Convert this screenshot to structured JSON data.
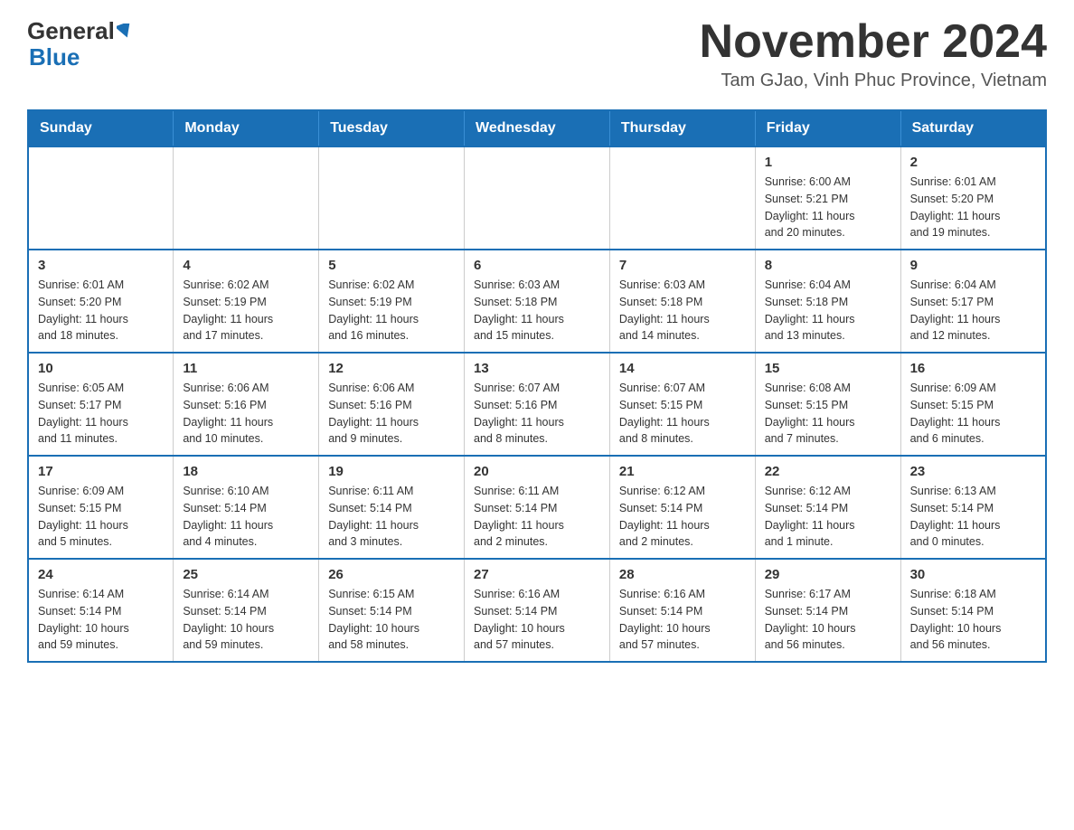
{
  "header": {
    "logo_general": "General",
    "logo_blue": "Blue",
    "title": "November 2024",
    "location": "Tam GJao, Vinh Phuc Province, Vietnam"
  },
  "calendar": {
    "days_of_week": [
      "Sunday",
      "Monday",
      "Tuesday",
      "Wednesday",
      "Thursday",
      "Friday",
      "Saturday"
    ],
    "weeks": [
      [
        {
          "day": "",
          "info": ""
        },
        {
          "day": "",
          "info": ""
        },
        {
          "day": "",
          "info": ""
        },
        {
          "day": "",
          "info": ""
        },
        {
          "day": "",
          "info": ""
        },
        {
          "day": "1",
          "info": "Sunrise: 6:00 AM\nSunset: 5:21 PM\nDaylight: 11 hours\nand 20 minutes."
        },
        {
          "day": "2",
          "info": "Sunrise: 6:01 AM\nSunset: 5:20 PM\nDaylight: 11 hours\nand 19 minutes."
        }
      ],
      [
        {
          "day": "3",
          "info": "Sunrise: 6:01 AM\nSunset: 5:20 PM\nDaylight: 11 hours\nand 18 minutes."
        },
        {
          "day": "4",
          "info": "Sunrise: 6:02 AM\nSunset: 5:19 PM\nDaylight: 11 hours\nand 17 minutes."
        },
        {
          "day": "5",
          "info": "Sunrise: 6:02 AM\nSunset: 5:19 PM\nDaylight: 11 hours\nand 16 minutes."
        },
        {
          "day": "6",
          "info": "Sunrise: 6:03 AM\nSunset: 5:18 PM\nDaylight: 11 hours\nand 15 minutes."
        },
        {
          "day": "7",
          "info": "Sunrise: 6:03 AM\nSunset: 5:18 PM\nDaylight: 11 hours\nand 14 minutes."
        },
        {
          "day": "8",
          "info": "Sunrise: 6:04 AM\nSunset: 5:18 PM\nDaylight: 11 hours\nand 13 minutes."
        },
        {
          "day": "9",
          "info": "Sunrise: 6:04 AM\nSunset: 5:17 PM\nDaylight: 11 hours\nand 12 minutes."
        }
      ],
      [
        {
          "day": "10",
          "info": "Sunrise: 6:05 AM\nSunset: 5:17 PM\nDaylight: 11 hours\nand 11 minutes."
        },
        {
          "day": "11",
          "info": "Sunrise: 6:06 AM\nSunset: 5:16 PM\nDaylight: 11 hours\nand 10 minutes."
        },
        {
          "day": "12",
          "info": "Sunrise: 6:06 AM\nSunset: 5:16 PM\nDaylight: 11 hours\nand 9 minutes."
        },
        {
          "day": "13",
          "info": "Sunrise: 6:07 AM\nSunset: 5:16 PM\nDaylight: 11 hours\nand 8 minutes."
        },
        {
          "day": "14",
          "info": "Sunrise: 6:07 AM\nSunset: 5:15 PM\nDaylight: 11 hours\nand 8 minutes."
        },
        {
          "day": "15",
          "info": "Sunrise: 6:08 AM\nSunset: 5:15 PM\nDaylight: 11 hours\nand 7 minutes."
        },
        {
          "day": "16",
          "info": "Sunrise: 6:09 AM\nSunset: 5:15 PM\nDaylight: 11 hours\nand 6 minutes."
        }
      ],
      [
        {
          "day": "17",
          "info": "Sunrise: 6:09 AM\nSunset: 5:15 PM\nDaylight: 11 hours\nand 5 minutes."
        },
        {
          "day": "18",
          "info": "Sunrise: 6:10 AM\nSunset: 5:14 PM\nDaylight: 11 hours\nand 4 minutes."
        },
        {
          "day": "19",
          "info": "Sunrise: 6:11 AM\nSunset: 5:14 PM\nDaylight: 11 hours\nand 3 minutes."
        },
        {
          "day": "20",
          "info": "Sunrise: 6:11 AM\nSunset: 5:14 PM\nDaylight: 11 hours\nand 2 minutes."
        },
        {
          "day": "21",
          "info": "Sunrise: 6:12 AM\nSunset: 5:14 PM\nDaylight: 11 hours\nand 2 minutes."
        },
        {
          "day": "22",
          "info": "Sunrise: 6:12 AM\nSunset: 5:14 PM\nDaylight: 11 hours\nand 1 minute."
        },
        {
          "day": "23",
          "info": "Sunrise: 6:13 AM\nSunset: 5:14 PM\nDaylight: 11 hours\nand 0 minutes."
        }
      ],
      [
        {
          "day": "24",
          "info": "Sunrise: 6:14 AM\nSunset: 5:14 PM\nDaylight: 10 hours\nand 59 minutes."
        },
        {
          "day": "25",
          "info": "Sunrise: 6:14 AM\nSunset: 5:14 PM\nDaylight: 10 hours\nand 59 minutes."
        },
        {
          "day": "26",
          "info": "Sunrise: 6:15 AM\nSunset: 5:14 PM\nDaylight: 10 hours\nand 58 minutes."
        },
        {
          "day": "27",
          "info": "Sunrise: 6:16 AM\nSunset: 5:14 PM\nDaylight: 10 hours\nand 57 minutes."
        },
        {
          "day": "28",
          "info": "Sunrise: 6:16 AM\nSunset: 5:14 PM\nDaylight: 10 hours\nand 57 minutes."
        },
        {
          "day": "29",
          "info": "Sunrise: 6:17 AM\nSunset: 5:14 PM\nDaylight: 10 hours\nand 56 minutes."
        },
        {
          "day": "30",
          "info": "Sunrise: 6:18 AM\nSunset: 5:14 PM\nDaylight: 10 hours\nand 56 minutes."
        }
      ]
    ]
  }
}
